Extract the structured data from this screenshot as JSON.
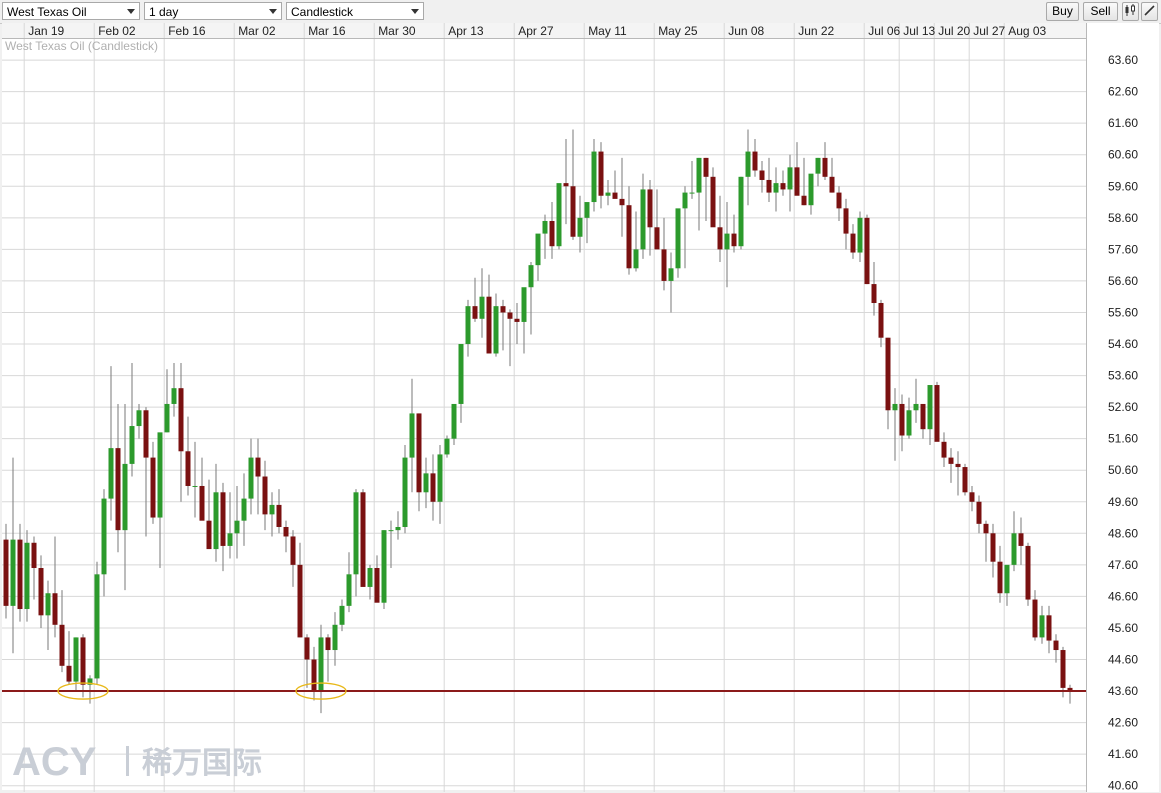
{
  "toolbar": {
    "instrument": "West Texas Oil",
    "interval": "1 day",
    "chart_type": "Candlestick",
    "buy_label": "Buy",
    "sell_label": "Sell"
  },
  "watermark": {
    "brand": "ACY",
    "chinese": "稀万国际"
  },
  "colors": {
    "up": "#2c9a2c",
    "down": "#7a1111",
    "support": "#8b1a1a",
    "ellipse": "#e8b818",
    "grid": "#d8d8d8"
  },
  "chart_data": {
    "type": "candlestick",
    "title": "West Texas Oil (Candlestick)",
    "x_tick_labels": [
      "Jan 19",
      "Feb 02",
      "Feb 16",
      "Mar 02",
      "Mar 16",
      "Mar 30",
      "Apr 13",
      "Apr 27",
      "May 11",
      "May 25",
      "Jun 08",
      "Jun 22",
      "Jul 06",
      "Jul 13",
      "Jul 20",
      "Jul 27",
      "Aug 03"
    ],
    "x_tick_bar_index": [
      4,
      14,
      24,
      34,
      44,
      54,
      64,
      74,
      84,
      94,
      104,
      114,
      124,
      129,
      134,
      139,
      144
    ],
    "y_ticks": [
      40.6,
      41.6,
      42.6,
      43.6,
      44.6,
      45.6,
      46.6,
      47.6,
      48.6,
      49.6,
      50.6,
      51.6,
      52.6,
      53.6,
      54.6,
      55.6,
      56.6,
      57.6,
      58.6,
      59.6,
      60.6,
      61.6,
      62.6,
      63.6
    ],
    "ylim": [
      40.4,
      64.3
    ],
    "support_level": 43.6,
    "highlight_circles": [
      {
        "bar_index": 11,
        "price": 43.6
      },
      {
        "bar_index": 45,
        "price": 43.6
      }
    ],
    "ohlc": [
      [
        48.4,
        48.9,
        45.9,
        46.3
      ],
      [
        46.3,
        51.0,
        44.8,
        48.4
      ],
      [
        48.4,
        48.9,
        45.8,
        46.2
      ],
      [
        46.2,
        48.7,
        45.8,
        48.3
      ],
      [
        48.3,
        48.5,
        46.5,
        47.5
      ],
      [
        47.5,
        47.9,
        45.6,
        46.0
      ],
      [
        46.0,
        47.1,
        44.9,
        46.7
      ],
      [
        46.7,
        48.5,
        45.3,
        45.7
      ],
      [
        45.7,
        46.8,
        44.2,
        44.4
      ],
      [
        44.4,
        45.5,
        43.8,
        43.9
      ],
      [
        43.9,
        45.3,
        43.6,
        45.3
      ],
      [
        45.3,
        45.4,
        43.4,
        43.8
      ],
      [
        43.8,
        44.1,
        43.2,
        44.0
      ],
      [
        44.0,
        47.7,
        43.8,
        47.3
      ],
      [
        47.3,
        50.0,
        46.6,
        49.7
      ],
      [
        49.7,
        53.9,
        49.0,
        51.3
      ],
      [
        51.3,
        52.7,
        48.0,
        48.7
      ],
      [
        48.7,
        52.7,
        46.8,
        50.8
      ],
      [
        50.8,
        54.0,
        50.4,
        52.0
      ],
      [
        52.0,
        52.7,
        51.6,
        52.5
      ],
      [
        52.5,
        52.6,
        48.5,
        51.0
      ],
      [
        51.0,
        51.5,
        48.9,
        49.1
      ],
      [
        49.1,
        51.2,
        47.5,
        51.8
      ],
      [
        51.8,
        53.8,
        51.8,
        52.7
      ],
      [
        52.7,
        54.0,
        52.3,
        53.2
      ],
      [
        53.2,
        54.0,
        49.6,
        51.2
      ],
      [
        51.2,
        52.3,
        49.8,
        50.1
      ],
      [
        50.1,
        51.5,
        49.1,
        50.1
      ],
      [
        50.1,
        51.0,
        49.2,
        49.0
      ],
      [
        49.0,
        50.3,
        48.3,
        48.1
      ],
      [
        48.1,
        50.8,
        47.7,
        49.9
      ],
      [
        49.9,
        50.2,
        47.4,
        48.2
      ],
      [
        48.2,
        49.9,
        47.8,
        48.6
      ],
      [
        48.6,
        50.1,
        47.8,
        49.0
      ],
      [
        49.0,
        50.5,
        48.2,
        49.7
      ],
      [
        49.7,
        51.6,
        49.2,
        51.0
      ],
      [
        51.0,
        51.6,
        49.2,
        50.4
      ],
      [
        50.4,
        50.9,
        48.7,
        49.2
      ],
      [
        49.2,
        49.9,
        48.5,
        49.5
      ],
      [
        49.5,
        50.0,
        48.6,
        48.8
      ],
      [
        48.8,
        49.0,
        48.0,
        48.5
      ],
      [
        48.5,
        48.7,
        46.9,
        47.6
      ],
      [
        47.6,
        48.3,
        45.3,
        45.3
      ],
      [
        45.3,
        45.4,
        43.7,
        44.6
      ],
      [
        44.6,
        45.0,
        43.3,
        43.6
      ],
      [
        43.6,
        45.7,
        42.9,
        45.3
      ],
      [
        45.3,
        45.4,
        43.9,
        44.9
      ],
      [
        44.9,
        46.1,
        44.4,
        45.7
      ],
      [
        45.7,
        46.5,
        45.5,
        46.3
      ],
      [
        46.3,
        48.0,
        46.1,
        47.3
      ],
      [
        47.3,
        50.0,
        46.6,
        49.9
      ],
      [
        49.9,
        50.0,
        47.5,
        46.9
      ],
      [
        46.9,
        47.6,
        46.5,
        47.5
      ],
      [
        47.5,
        47.9,
        46.6,
        46.4
      ],
      [
        46.4,
        48.7,
        46.2,
        48.7
      ],
      [
        48.7,
        49.0,
        47.5,
        48.7
      ],
      [
        48.7,
        49.3,
        48.4,
        48.8
      ],
      [
        48.8,
        51.4,
        48.6,
        51.0
      ],
      [
        51.0,
        53.5,
        49.9,
        52.4
      ],
      [
        52.4,
        52.4,
        49.3,
        49.9
      ],
      [
        49.9,
        51.0,
        49.4,
        50.5
      ],
      [
        50.5,
        51.1,
        49.0,
        49.6
      ],
      [
        49.6,
        51.4,
        48.9,
        51.1
      ],
      [
        51.1,
        51.7,
        51.0,
        51.6
      ],
      [
        51.6,
        52.6,
        51.4,
        52.7
      ],
      [
        52.7,
        54.5,
        52.1,
        54.6
      ],
      [
        54.6,
        56.0,
        54.2,
        55.8
      ],
      [
        55.8,
        56.7,
        55.3,
        55.4
      ],
      [
        55.4,
        57.0,
        54.8,
        56.1
      ],
      [
        56.1,
        56.8,
        54.5,
        54.3
      ],
      [
        54.3,
        56.2,
        54.2,
        55.8
      ],
      [
        55.8,
        56.0,
        54.4,
        55.6
      ],
      [
        55.6,
        55.7,
        53.9,
        55.4
      ],
      [
        55.4,
        55.9,
        54.6,
        55.3
      ],
      [
        55.3,
        55.6,
        54.3,
        56.4
      ],
      [
        56.4,
        57.2,
        54.9,
        57.1
      ],
      [
        57.1,
        57.8,
        56.6,
        58.1
      ],
      [
        58.1,
        58.7,
        57.3,
        58.5
      ],
      [
        58.5,
        59.1,
        57.3,
        57.7
      ],
      [
        57.7,
        59.3,
        57.6,
        59.7
      ],
      [
        59.7,
        61.1,
        58.4,
        59.6
      ],
      [
        59.6,
        61.4,
        57.9,
        58.0
      ],
      [
        58.0,
        59.3,
        57.5,
        58.6
      ],
      [
        58.6,
        59.0,
        57.8,
        59.1
      ],
      [
        59.1,
        61.1,
        58.8,
        60.7
      ],
      [
        60.7,
        61.0,
        58.9,
        59.3
      ],
      [
        59.3,
        59.8,
        59.0,
        59.4
      ],
      [
        59.4,
        60.1,
        59.4,
        59.2
      ],
      [
        59.2,
        60.5,
        58.0,
        59.0
      ],
      [
        59.0,
        59.6,
        56.8,
        57.0
      ],
      [
        57.0,
        58.8,
        56.9,
        57.6
      ],
      [
        57.6,
        60.0,
        57.3,
        59.5
      ],
      [
        59.5,
        59.8,
        57.4,
        58.3
      ],
      [
        58.3,
        59.5,
        58.0,
        57.6
      ],
      [
        57.6,
        58.6,
        56.3,
        56.6
      ],
      [
        56.6,
        57.5,
        55.6,
        57.0
      ],
      [
        57.0,
        58.6,
        56.7,
        58.9
      ],
      [
        58.9,
        59.6,
        57.0,
        59.4
      ],
      [
        59.4,
        60.4,
        59.2,
        59.4
      ],
      [
        59.4,
        60.5,
        58.2,
        60.5
      ],
      [
        60.5,
        60.5,
        58.5,
        59.9
      ],
      [
        59.9,
        60.2,
        58.4,
        58.3
      ],
      [
        58.3,
        59.3,
        57.2,
        57.6
      ],
      [
        57.6,
        59.1,
        56.4,
        58.1
      ],
      [
        58.1,
        58.7,
        57.5,
        57.7
      ],
      [
        57.7,
        59.9,
        57.6,
        59.9
      ],
      [
        59.9,
        61.4,
        59.0,
        60.7
      ],
      [
        60.7,
        61.1,
        59.9,
        60.1
      ],
      [
        60.1,
        60.4,
        59.4,
        59.8
      ],
      [
        59.8,
        60.5,
        59.1,
        59.4
      ],
      [
        59.4,
        60.2,
        58.8,
        59.7
      ],
      [
        59.7,
        60.1,
        59.3,
        59.5
      ],
      [
        59.5,
        60.6,
        58.8,
        60.2
      ],
      [
        60.2,
        61.0,
        59.8,
        59.3
      ],
      [
        59.3,
        60.5,
        59.0,
        59.0
      ],
      [
        59.0,
        59.4,
        58.7,
        60.0
      ],
      [
        60.0,
        60.5,
        59.6,
        60.5
      ],
      [
        60.5,
        61.0,
        59.8,
        59.9
      ],
      [
        59.9,
        60.5,
        59.4,
        59.4
      ],
      [
        59.4,
        59.6,
        58.5,
        58.9
      ],
      [
        58.9,
        59.2,
        57.6,
        58.1
      ],
      [
        58.1,
        58.4,
        57.3,
        57.5
      ],
      [
        57.5,
        58.8,
        57.2,
        58.6
      ],
      [
        58.6,
        58.7,
        56.5,
        56.5
      ],
      [
        56.5,
        57.2,
        55.5,
        55.9
      ],
      [
        55.9,
        56.0,
        54.5,
        54.8
      ],
      [
        54.8,
        54.8,
        51.9,
        52.5
      ],
      [
        52.5,
        53.2,
        50.9,
        52.7
      ],
      [
        52.7,
        53.0,
        51.2,
        51.7
      ],
      [
        51.7,
        52.9,
        51.6,
        52.5
      ],
      [
        52.5,
        53.5,
        52.1,
        52.7
      ],
      [
        52.7,
        52.7,
        51.6,
        51.9
      ],
      [
        51.9,
        52.7,
        51.4,
        53.3
      ],
      [
        53.3,
        53.4,
        51.6,
        51.5
      ],
      [
        51.5,
        51.8,
        50.7,
        51.0
      ],
      [
        51.0,
        51.3,
        50.2,
        50.8
      ],
      [
        50.8,
        51.2,
        49.8,
        50.7
      ],
      [
        50.7,
        50.8,
        49.8,
        49.9
      ],
      [
        49.9,
        50.1,
        49.3,
        49.6
      ],
      [
        49.6,
        49.8,
        48.6,
        48.9
      ],
      [
        48.9,
        49.0,
        47.7,
        48.6
      ],
      [
        48.6,
        48.9,
        47.2,
        47.7
      ],
      [
        47.7,
        48.2,
        46.4,
        46.7
      ],
      [
        46.7,
        47.0,
        46.3,
        47.6
      ],
      [
        47.6,
        49.3,
        47.4,
        48.6
      ],
      [
        48.6,
        49.1,
        47.6,
        48.2
      ],
      [
        48.2,
        48.3,
        46.3,
        46.5
      ],
      [
        46.5,
        46.8,
        45.2,
        45.3
      ],
      [
        45.3,
        46.3,
        45.1,
        46.0
      ],
      [
        46.0,
        46.3,
        44.8,
        45.2
      ],
      [
        45.2,
        45.4,
        44.5,
        44.9
      ],
      [
        44.9,
        45.0,
        43.4,
        43.7
      ],
      [
        43.7,
        43.8,
        43.2,
        43.6
      ]
    ]
  }
}
